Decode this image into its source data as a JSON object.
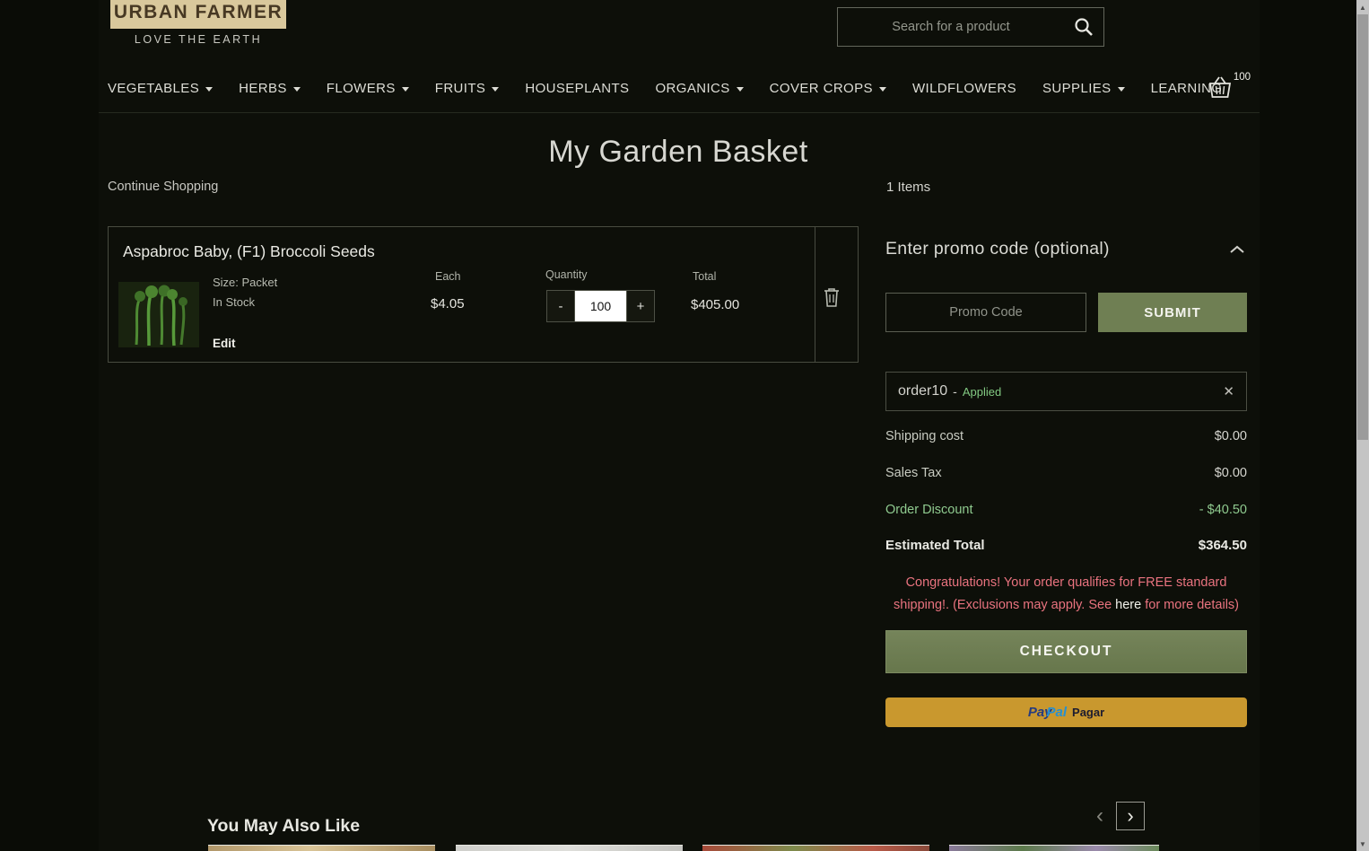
{
  "brand": {
    "name": "URBAN FARMER",
    "tagline": "LOVE THE EARTH"
  },
  "search": {
    "placeholder": "Search for a product"
  },
  "nav": {
    "items": [
      {
        "label": "VEGETABLES"
      },
      {
        "label": "HERBS"
      },
      {
        "label": "FLOWERS"
      },
      {
        "label": "FRUITS"
      },
      {
        "label": "HOUSEPLANTS"
      },
      {
        "label": "ORGANICS"
      },
      {
        "label": "COVER CROPS"
      },
      {
        "label": "WILDFLOWERS"
      },
      {
        "label": "SUPPLIES"
      },
      {
        "label": "LEARNING"
      }
    ],
    "cart_count": "100"
  },
  "page": {
    "title": "My Garden Basket",
    "continue_shopping": "Continue Shopping",
    "items_count": "1 Items"
  },
  "cart_item": {
    "name": "Aspabroc Baby, (F1) Broccoli Seeds",
    "size": "Size: Packet",
    "stock": "In Stock",
    "edit": "Edit",
    "each_label": "Each",
    "each_price": "$4.05",
    "quantity_label": "Quantity",
    "quantity": "100",
    "minus": "-",
    "plus": "+",
    "total_label": "Total",
    "total": "$405.00"
  },
  "summary": {
    "promo_title": "Enter promo code (optional)",
    "promo_placeholder": "Promo Code",
    "submit": "SUBMIT",
    "applied": {
      "code": "order10",
      "dash": "-",
      "label": "Applied"
    },
    "close": "✕",
    "rows": [
      {
        "label": "Shipping cost",
        "value": "$0.00"
      },
      {
        "label": "Sales Tax",
        "value": "$0.00"
      },
      {
        "label": "Order Discount",
        "value": "- $40.50"
      },
      {
        "label": "Estimated Total",
        "value": "$364.50"
      }
    ],
    "note_line1": "Congratulations! Your order qualifies for FREE standard",
    "note_line2_pre": "shipping!. (Exclusions may apply. See ",
    "note_link": "here",
    "note_line2_post": " for more details)",
    "checkout": "CHECKOUT",
    "paypal": {
      "pay": "Pay",
      "pal": "Pal",
      "label": "Pagar"
    }
  },
  "recommendations": {
    "title": "You May Also Like",
    "prev": "‹",
    "next": "›"
  },
  "colors": {
    "accent_green": "#6f7f53",
    "discount_green": "#8fca8f",
    "alert_red": "#e9737f",
    "paypal_gold": "#c9982e",
    "logo_tan": "#d9c89c"
  }
}
